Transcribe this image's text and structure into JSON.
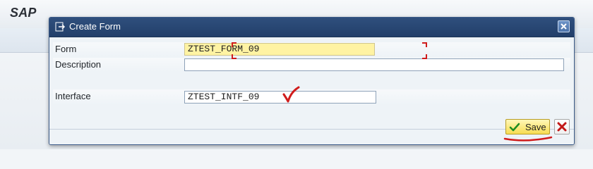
{
  "app": {
    "title": "SAP"
  },
  "dialog": {
    "title": "Create Form",
    "fields": {
      "form": {
        "label": "Form",
        "value": "ZTEST_FORM_09"
      },
      "description": {
        "label": "Description",
        "value": ""
      },
      "interface": {
        "label": "Interface",
        "value": "ZTEST_INTF_09"
      }
    },
    "buttons": {
      "save": "Save"
    }
  },
  "icons": {
    "title_icon": "create-form-icon",
    "close": "close-icon",
    "save": "check-icon",
    "cancel": "cancel-icon"
  },
  "colors": {
    "title_bar": "#2f4f7d",
    "required_field": "#fff3a3",
    "save_button": "#f7dd54",
    "annotation": "#d01c1c"
  }
}
